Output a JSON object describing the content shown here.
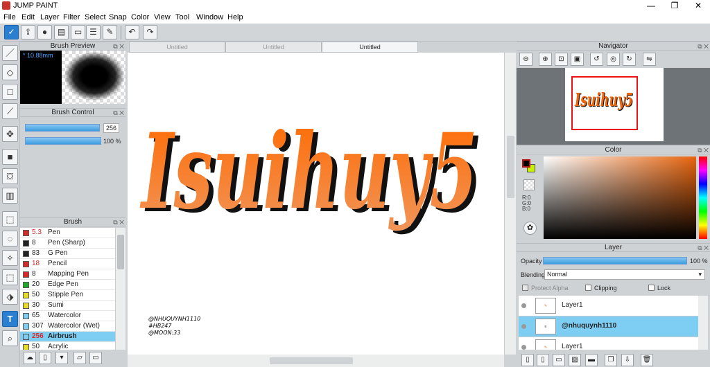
{
  "window": {
    "title": "JUMP PAINT",
    "minimize": "—",
    "maximize": "❐",
    "close": "✕"
  },
  "menu": [
    "File",
    "Edit",
    "Layer",
    "Filter",
    "Select",
    "Snap",
    "Color",
    "View",
    "Tool",
    "Window",
    "Help"
  ],
  "panels": {
    "brush_preview": "Brush Preview",
    "brush_control": "Brush Control",
    "brush": "Brush",
    "navigator": "Navigator",
    "color": "Color",
    "layer": "Layer"
  },
  "brush_preview": {
    "size": "* 10.88mm"
  },
  "brush_control": {
    "size_value": "256",
    "opacity_value": "100 %",
    "size_fraction": 1.0,
    "opacity_fraction": 1.0
  },
  "brushes": [
    {
      "size": "5.3",
      "name": "Pen",
      "color": "#d42a2a",
      "size_color": "#d42a2a"
    },
    {
      "size": "8",
      "name": "Pen (Sharp)",
      "color": "#222222",
      "size_color": "#222222"
    },
    {
      "size": "83",
      "name": "G Pen",
      "color": "#222222",
      "size_color": "#222222"
    },
    {
      "size": "18",
      "name": "Pencil",
      "color": "#d42a2a",
      "size_color": "#d42a2a"
    },
    {
      "size": "8",
      "name": "Mapping Pen",
      "color": "#d42a2a",
      "size_color": "#222222"
    },
    {
      "size": "20",
      "name": "Edge Pen",
      "color": "#22a82a",
      "size_color": "#222222"
    },
    {
      "size": "50",
      "name": "Stipple Pen",
      "color": "#e8dc2a",
      "size_color": "#222222"
    },
    {
      "size": "30",
      "name": "Sumi",
      "color": "#e8dc2a",
      "size_color": "#222222"
    },
    {
      "size": "65",
      "name": "Watercolor",
      "color": "#7ecef4",
      "size_color": "#222222"
    },
    {
      "size": "307",
      "name": "Watercolor (Wet)",
      "color": "#7ecef4",
      "size_color": "#222222"
    },
    {
      "size": "256",
      "name": "Airbrush",
      "color": "#7ecef4",
      "size_color": "#d42a2a",
      "selected": true
    },
    {
      "size": "50",
      "name": "Acrylic",
      "color": "#e8dc2a",
      "size_color": "#222222"
    }
  ],
  "tabs": [
    {
      "label": "Untitled",
      "active": false
    },
    {
      "label": "Untitled",
      "active": false
    },
    {
      "label": "Untitled",
      "active": true
    }
  ],
  "canvas": {
    "artwork_text": "Isuihuy5",
    "signature": [
      "@NHUQUYNH1110",
      "#HB247",
      "@MOON:33"
    ],
    "art_color": "#f0650a",
    "shadow_color": "#111111"
  },
  "color": {
    "r": "R:0",
    "g": "G:0",
    "b": "B:0",
    "main": "#000000",
    "sub": "#c6f000",
    "hue": "#e8650f"
  },
  "layer": {
    "opacity_label": "Opacity",
    "opacity_value": "100 %",
    "blending_label": "Blending",
    "blending_value": "Normal",
    "protect_alpha": "Protect Alpha",
    "clipping": "Clipping",
    "lock": "Lock",
    "layers": [
      {
        "name": "Layer1",
        "selected": false
      },
      {
        "name": "@nhuquynh1110",
        "selected": true
      },
      {
        "name": "Layer1",
        "selected": false
      }
    ]
  }
}
